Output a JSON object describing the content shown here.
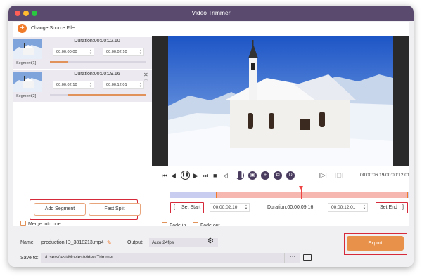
{
  "window": {
    "title": "Video Trimmer"
  },
  "toolbar": {
    "change_source_label": "Change Source File"
  },
  "segments": [
    {
      "label": "Segment[1]",
      "duration": "Duration:00:00:02.10",
      "start": "00:00:00.00",
      "end": "00:00:02.10",
      "progress_start": 0.0,
      "progress_end": 0.19
    },
    {
      "label": "Segment[2]",
      "duration": "Duration:00:00:09.16",
      "start": "00:00:02.10",
      "end": "00:00:12.01",
      "progress_start": 0.19,
      "progress_end": 1.0
    }
  ],
  "segment_buttons": {
    "add_segment": "Add Segment",
    "fast_split": "Fast Split"
  },
  "merge": {
    "label": "Merge into one",
    "checked": false
  },
  "playback": {
    "timecode": "00:00:06.19/00:00:12.01",
    "position_fraction": 0.546
  },
  "trim": {
    "set_start_label": "Set Start",
    "start": "00:00:02.10",
    "duration": "Duration:00:00:09.16",
    "end": "00:00:12.01",
    "set_end_label": "Set End",
    "selection_start_fraction": 0.19,
    "selection_end_fraction": 1.0
  },
  "fade": {
    "fade_in_label": "Fade in",
    "fade_out_label": "Fade out",
    "fade_in_checked": false,
    "fade_out_checked": false
  },
  "output": {
    "name_label": "Name:",
    "name_value": "production ID_3818213.mp4",
    "output_label": "Output:",
    "output_value": "Auto;24fps",
    "save_label": "Save to:",
    "save_path": "/Users/test/Movies/Video Trimmer",
    "browse_label": "···",
    "export_label": "Export"
  },
  "icons": {
    "add": "plus-circle-icon",
    "close": "close-icon",
    "up": "chevron-up-icon",
    "down": "chevron-down-icon",
    "edit": "pencil-icon",
    "settings": "gear-icon",
    "folder": "folder-icon"
  },
  "colors": {
    "accent": "#f07b2a",
    "titlebar": "#5a4b6e",
    "highlight": "#d62a3a",
    "trim_selection": "#f6b7b0",
    "trim_track": "#c9cdf0"
  }
}
